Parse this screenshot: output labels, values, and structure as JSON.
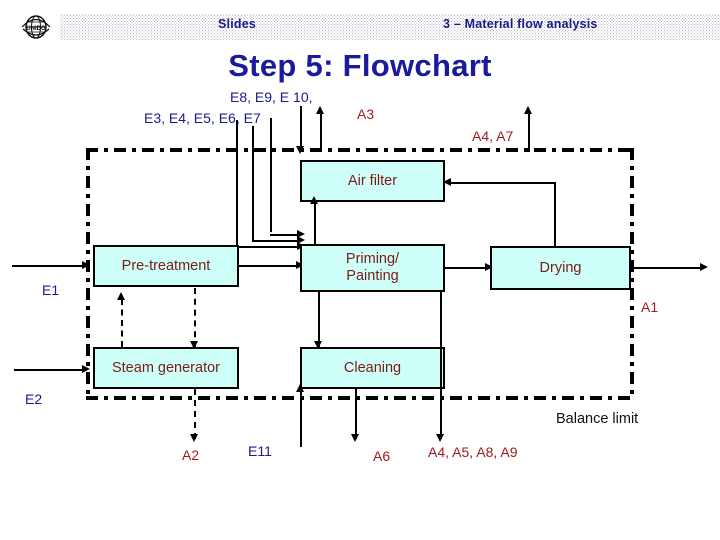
{
  "header": {
    "left_label": "Slides",
    "right_label": "3 – Material flow analysis",
    "logo_icon": "unido-globe-logo-icon"
  },
  "title": "Step 5: Flowchart",
  "boxes": [
    {
      "id": "air-filter",
      "label": "Air filter"
    },
    {
      "id": "pre-treatment",
      "label": "Pre-treatment"
    },
    {
      "id": "priming-painting",
      "label_line1": "Priming/",
      "label_line2": "Painting"
    },
    {
      "id": "drying",
      "label": "Drying"
    },
    {
      "id": "steam-generator",
      "label": "Steam generator"
    },
    {
      "id": "cleaning",
      "label": "Cleaning"
    }
  ],
  "flows": {
    "inputs_top_1": "E8, E9, E 10,",
    "inputs_top_2": "E3, E4, E5, E6, E7",
    "input_left": "E1",
    "input_left_lower": "E2",
    "input_bottom": "E11",
    "output_top_1": "A3",
    "output_top_2": "A4, A7",
    "output_right": "A1",
    "output_bottom_1": "A2",
    "output_bottom_2": "A6",
    "output_bottom_3": "A4, A5, A8, A9"
  },
  "annotations": {
    "balance_limit": "Balance limit"
  },
  "colors": {
    "title_blue": "#1a1a9c",
    "input_blue": "#1a1a8c",
    "output_red": "#9e1b20",
    "box_fill": "#cdfff8",
    "box_text": "#7b1b18",
    "boundary": "#000000"
  }
}
